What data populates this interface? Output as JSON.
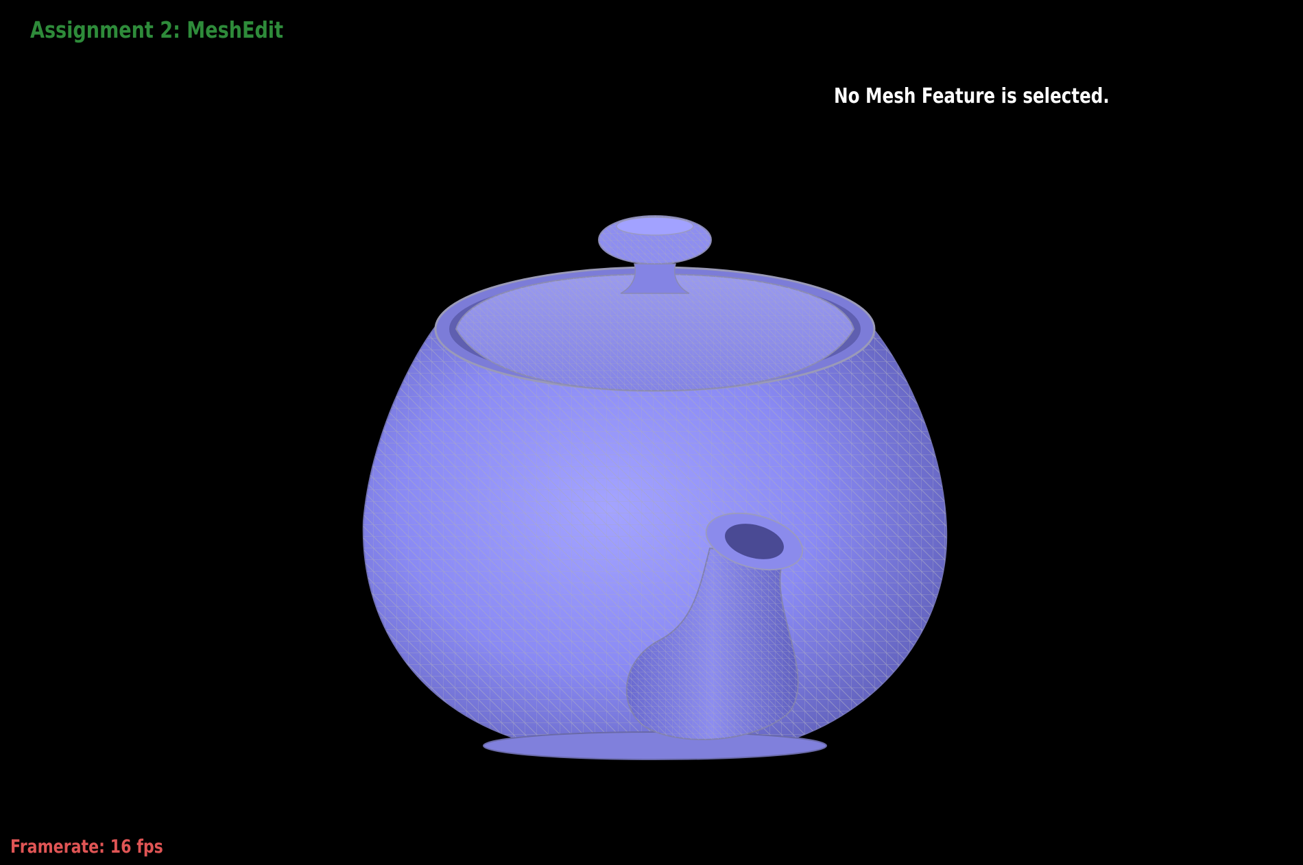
{
  "app": {
    "title": "Assignment 2: MeshEdit",
    "status_message": "No Mesh Feature is selected.",
    "framerate_label": "Framerate: 16 fps"
  },
  "colors": {
    "background": "#000000",
    "title": "#2e8b3a",
    "status": "#ffffff",
    "framerate": "#e05555",
    "mesh_fill": "#8c8cf2",
    "mesh_wire": "#9a9ab0"
  },
  "viewport": {
    "object": "teapot",
    "render_mode": "shaded-wireframe"
  }
}
